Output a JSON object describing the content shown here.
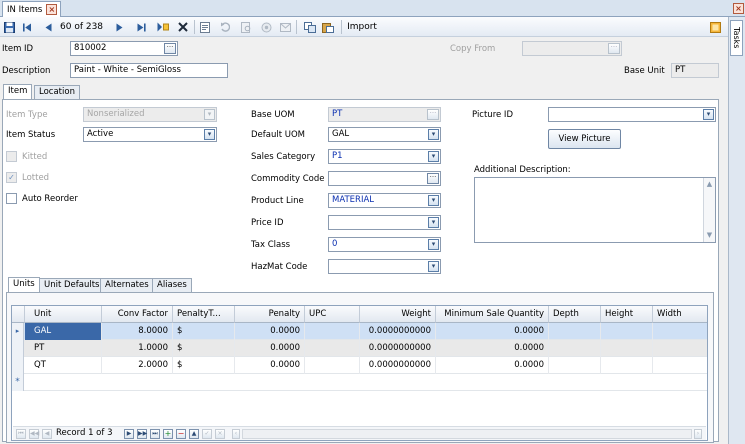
{
  "window": {
    "tab_title": "IN Items"
  },
  "toolbar": {
    "record_position": "60 of 238",
    "import_label": "Import"
  },
  "side_panel": {
    "tasks_label": "Tasks"
  },
  "header": {
    "item_id_label": "Item ID",
    "item_id_value": "810002",
    "copy_from_label": "Copy From",
    "copy_from_value": "",
    "description_label": "Description",
    "description_value": "Paint - White - SemiGloss",
    "base_unit_label": "Base Unit",
    "base_unit_value": "PT"
  },
  "form_tabs": [
    {
      "label": "Item",
      "active": true
    },
    {
      "label": "Location",
      "active": false
    }
  ],
  "item_tab": {
    "item_type_label": "Item Type",
    "item_type_value": "Nonserialized",
    "item_status_label": "Item Status",
    "item_status_value": "Active",
    "kitted_label": "Kitted",
    "kitted_checked": false,
    "lotted_label": "Lotted",
    "lotted_checked": true,
    "auto_reorder_label": "Auto Reorder",
    "auto_reorder_checked": false,
    "base_uom_label": "Base UOM",
    "base_uom_value": "PT",
    "default_uom_label": "Default UOM",
    "default_uom_value": "GAL",
    "sales_category_label": "Sales Category",
    "sales_category_value": "P1",
    "commodity_code_label": "Commodity Code",
    "commodity_code_value": "",
    "product_line_label": "Product Line",
    "product_line_value": "MATERIAL",
    "price_id_label": "Price ID",
    "price_id_value": "",
    "tax_class_label": "Tax Class",
    "tax_class_value": "0",
    "hazmat_code_label": "HazMat Code",
    "hazmat_code_value": "",
    "picture_id_label": "Picture ID",
    "picture_id_value": "",
    "view_picture_label": "View Picture",
    "additional_description_label": "Additional Description:",
    "additional_description_value": ""
  },
  "sub_tabs": [
    {
      "label": "Units",
      "active": true
    },
    {
      "label": "Unit Defaults",
      "active": false
    },
    {
      "label": "Alternates",
      "active": false
    },
    {
      "label": "Aliases",
      "active": false
    }
  ],
  "units_grid": {
    "columns": [
      "Unit",
      "Conv Factor",
      "PenaltyT...",
      "Penalty",
      "UPC",
      "Weight",
      "Minimum Sale Quantity",
      "Depth",
      "Height",
      "Width"
    ],
    "rows": [
      {
        "unit": "GAL",
        "conv_factor": "8.0000",
        "penalty_type": "$",
        "penalty": "0.0000",
        "upc": "",
        "weight": "0.0000000000",
        "min_sale_qty": "0.0000",
        "depth": "",
        "height": "",
        "width": ""
      },
      {
        "unit": "PT",
        "conv_factor": "1.0000",
        "penalty_type": "$",
        "penalty": "0.0000",
        "upc": "",
        "weight": "0.0000000000",
        "min_sale_qty": "0.0000",
        "depth": "",
        "height": "",
        "width": ""
      },
      {
        "unit": "QT",
        "conv_factor": "2.0000",
        "penalty_type": "$",
        "penalty": "0.0000",
        "upc": "",
        "weight": "0.0000000000",
        "min_sale_qty": "0.0000",
        "depth": "",
        "height": "",
        "width": ""
      }
    ],
    "new_row_marker": "*",
    "record_status": "Record 1 of 3"
  },
  "colors": {
    "accent": "#3a68a8",
    "selected_row": "#cfe0f5",
    "value_blue": "#0a2fb0"
  }
}
